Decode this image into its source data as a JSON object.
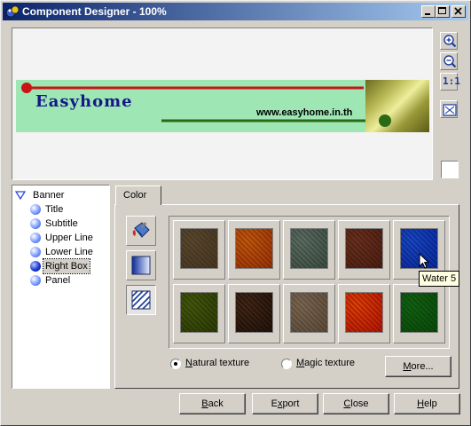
{
  "window": {
    "title": "Component Designer - 100%"
  },
  "preview": {
    "banner_title": "Easyhome",
    "banner_url": "www.easyhome.in.th",
    "colors": {
      "background": "#9ee6b4",
      "upper_line": "#c81414",
      "lower_line": "#2a6a14",
      "title": "#16178a"
    }
  },
  "side_tools": {
    "icons": [
      "zoom-in-icon",
      "zoom-out-icon",
      "actual-size-icon",
      "fit-icon"
    ],
    "actual_size_label": "1:1"
  },
  "tree": {
    "root": "Banner",
    "items": [
      {
        "label": "Title"
      },
      {
        "label": "Subtitle"
      },
      {
        "label": "Upper Line"
      },
      {
        "label": "Lower Line"
      },
      {
        "label": "Right Box",
        "selected": true
      },
      {
        "label": "Panel"
      }
    ]
  },
  "tab": {
    "label": "Color"
  },
  "tools": {
    "icons": [
      "paint-bucket-icon",
      "gradient-icon",
      "texture-icon"
    ]
  },
  "textures": [
    {
      "name": "texture-sand",
      "colors": [
        "#7a6a52",
        "#9a8a6e"
      ]
    },
    {
      "name": "texture-autumn-leaves",
      "colors": [
        "#b25a1a",
        "#e0a040"
      ]
    },
    {
      "name": "texture-pebbles",
      "colors": [
        "#6a7a70",
        "#a0aca4"
      ]
    },
    {
      "name": "texture-soil",
      "colors": [
        "#7a4a34",
        "#a87460"
      ]
    },
    {
      "name": "texture-water",
      "colors": [
        "#1f53b4",
        "#5c8ee0"
      ]
    },
    {
      "name": "texture-moss",
      "colors": [
        "#5a6a1a",
        "#8a9a3e"
      ]
    },
    {
      "name": "texture-bark",
      "colors": [
        "#4a3424",
        "#8a6a54"
      ]
    },
    {
      "name": "texture-stone",
      "colors": [
        "#8a7a6a",
        "#b4a694"
      ]
    },
    {
      "name": "texture-flowers",
      "colors": [
        "#c03010",
        "#f09030"
      ]
    },
    {
      "name": "texture-grass",
      "colors": [
        "#2a7a2a",
        "#4aa04a"
      ]
    }
  ],
  "tooltip": "Water 5",
  "radios": [
    {
      "label": "Natural texture",
      "checked": true
    },
    {
      "label": "Magic texture",
      "checked": false
    }
  ],
  "more_button": "More...",
  "buttons": {
    "back": "Back",
    "export": "Export",
    "close": "Close",
    "help": "Help"
  }
}
